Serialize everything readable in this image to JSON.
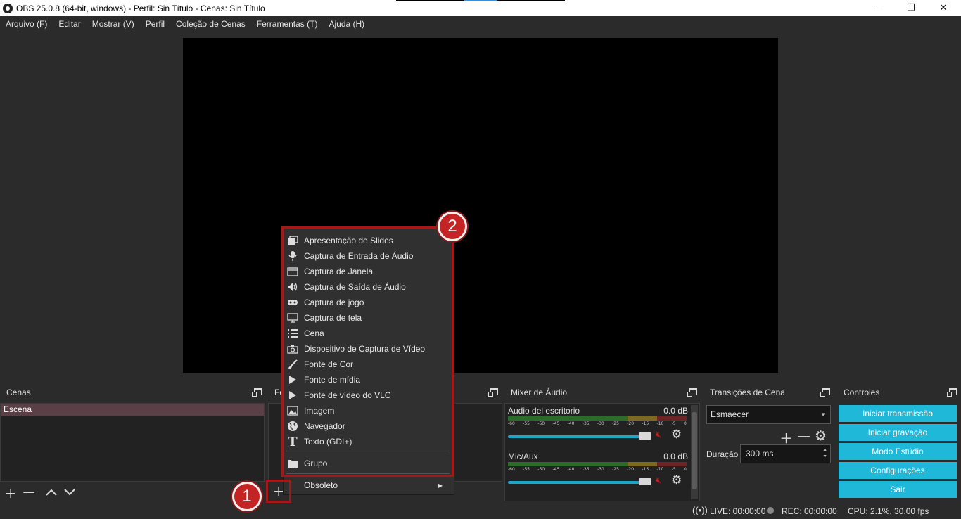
{
  "window": {
    "title": "OBS 25.0.8 (64-bit, windows) - Perfil: Sin Título - Cenas: Sin Título",
    "minimize": "—",
    "maximize": "❐",
    "close": "✕"
  },
  "menubar": [
    "Arquivo (F)",
    "Editar",
    "Mostrar (V)",
    "Perfil",
    "Coleção de Cenas",
    "Ferramentas (T)",
    "Ajuda (H)"
  ],
  "docks": {
    "scenes": {
      "title": "Cenas",
      "items": [
        "Escena"
      ]
    },
    "sources": {
      "title_partial": "Fo"
    },
    "mixer": {
      "title": "Mixer de Áudio",
      "channels": [
        {
          "name": "Audio del escritorio",
          "db": "0.0 dB"
        },
        {
          "name": "Mic/Aux",
          "db": "0.0 dB"
        }
      ],
      "ticks": [
        "-60",
        "-55",
        "-50",
        "-45",
        "-40",
        "-35",
        "-30",
        "-25",
        "-20",
        "-15",
        "-10",
        "-5",
        "0"
      ]
    },
    "transitions": {
      "title": "Transições de Cena",
      "selected": "Esmaecer",
      "duration_label": "Duração",
      "duration_value": "300 ms"
    },
    "controls": {
      "title": "Controles",
      "buttons": [
        "Iniciar transmissão",
        "Iniciar gravação",
        "Modo Estúdio",
        "Configurações",
        "Sair"
      ]
    }
  },
  "context_menu": {
    "items": [
      {
        "label": "Apresentação de Slides",
        "icon": "slideshow-icon"
      },
      {
        "label": "Captura de Entrada de Áudio",
        "icon": "microphone-icon"
      },
      {
        "label": "Captura de Janela",
        "icon": "window-icon"
      },
      {
        "label": "Captura de Saída de Áudio",
        "icon": "speaker-icon"
      },
      {
        "label": "Captura de jogo",
        "icon": "gamepad-icon"
      },
      {
        "label": "Captura de tela",
        "icon": "monitor-icon"
      },
      {
        "label": "Cena",
        "icon": "list-icon"
      },
      {
        "label": "Dispositivo de Captura de Vídeo",
        "icon": "camera-icon"
      },
      {
        "label": "Fonte de Cor",
        "icon": "brush-icon"
      },
      {
        "label": "Fonte de mídia",
        "icon": "play-icon"
      },
      {
        "label": "Fonte de vídeo do VLC",
        "icon": "play-icon"
      },
      {
        "label": "Imagem",
        "icon": "image-icon"
      },
      {
        "label": "Navegador",
        "icon": "globe-icon"
      },
      {
        "label": "Texto (GDI+)",
        "icon": "text-icon"
      }
    ],
    "group": "Grupo",
    "obsolete": "Obsoleto"
  },
  "annotations": {
    "badge1": "1",
    "badge2": "2"
  },
  "status": {
    "live": "LIVE: 00:00:00",
    "rec": "REC: 00:00:00",
    "cpu": "CPU: 2.1%, 30.00 fps"
  },
  "colors": {
    "accent": "#1fb8d8",
    "highlight": "#a31919",
    "selection": "#5a3f47"
  }
}
